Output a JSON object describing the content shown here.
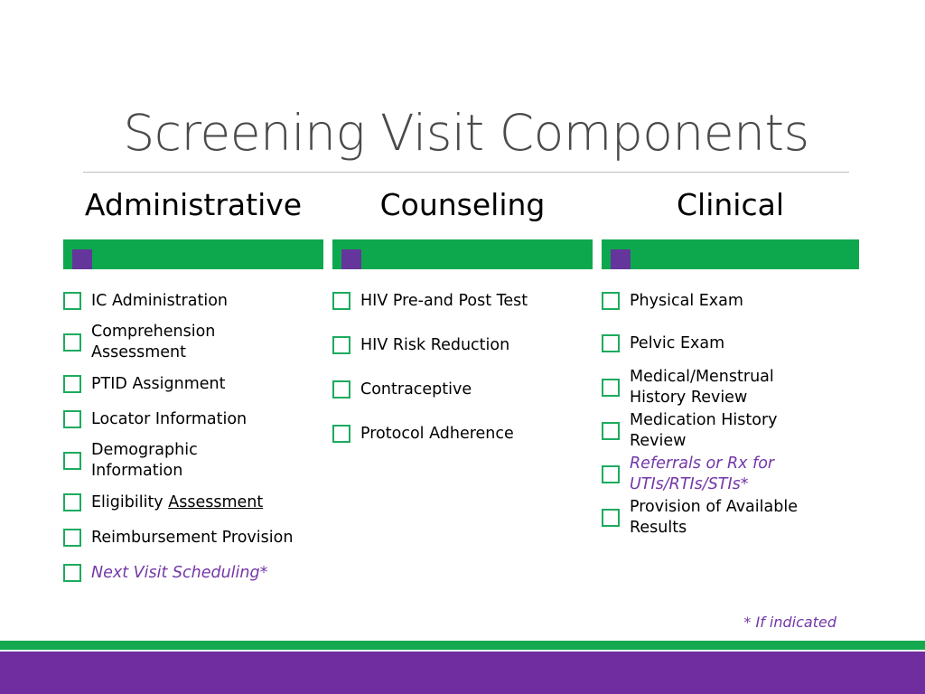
{
  "slide": {
    "title": "Screening Visit Components",
    "footnote": "* If indicated",
    "colors": {
      "green_bar": "#0DA84E",
      "purple_square": "#64359B",
      "checkbox_border": "#1DAB5E",
      "purple_text": "#7337A8",
      "band_green": "#14A94F",
      "band_purple": "#6F2DA0",
      "title_text": "#4a4a4a"
    }
  },
  "columns": [
    {
      "header": "Administrative",
      "items": [
        {
          "label": "IC Administration",
          "style": "normal"
        },
        {
          "label": "Comprehension Assessment",
          "style": "normal"
        },
        {
          "label": "PTID Assignment",
          "style": "normal"
        },
        {
          "label": "Locator Information",
          "style": "normal"
        },
        {
          "label": "Demographic Information",
          "style": "normal"
        },
        {
          "label": "Eligibility Assessment",
          "style": "underline-part",
          "plain": "Eligibility ",
          "underlined": "Assessment"
        },
        {
          "label": "Reimbursement Provision",
          "style": "normal"
        },
        {
          "label": "Next Visit Scheduling*",
          "style": "purple-italic"
        }
      ]
    },
    {
      "header": "Counseling",
      "items": [
        {
          "label": "HIV Pre-and Post Test",
          "style": "normal"
        },
        {
          "label": "HIV Risk Reduction",
          "style": "normal"
        },
        {
          "label": "Contraceptive",
          "style": "normal"
        },
        {
          "label": "Protocol Adherence",
          "style": "normal"
        }
      ]
    },
    {
      "header": "Clinical",
      "items": [
        {
          "label": "Physical Exam",
          "style": "normal"
        },
        {
          "label": "Pelvic Exam",
          "style": "normal"
        },
        {
          "label": "Medical/Menstrual History Review",
          "style": "normal"
        },
        {
          "label": "Medication History Review",
          "style": "normal"
        },
        {
          "label": "Referrals or Rx for UTIs/RTIs/STIs*",
          "style": "purple-italic"
        },
        {
          "label": "Provision of Available Results",
          "style": "normal"
        }
      ]
    }
  ]
}
